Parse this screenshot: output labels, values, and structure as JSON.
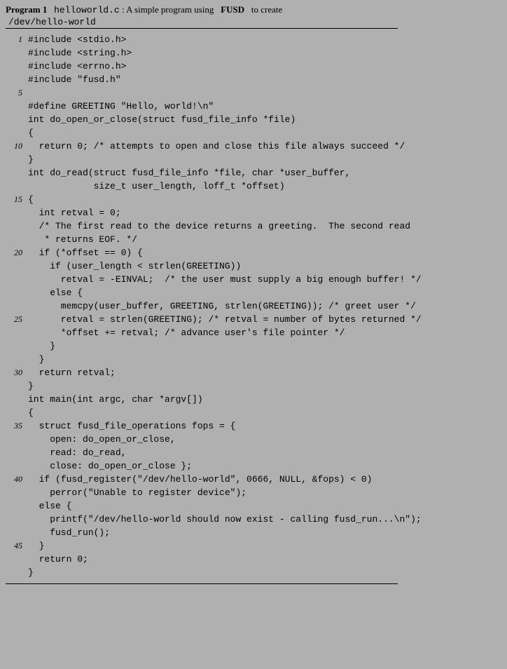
{
  "header": {
    "program_label": "Program  1",
    "filename": "helloworld.c",
    "desc_pre": ":   A  simple  program  using",
    "fusd": "FUSD",
    "desc_post": "to  create",
    "devpath": "/dev/hello-world"
  },
  "code": [
    {
      "n": "1",
      "t": "#include <stdio.h>"
    },
    {
      "n": "",
      "t": "#include <string.h>"
    },
    {
      "n": "",
      "t": "#include <errno.h>"
    },
    {
      "n": "",
      "t": "#include \"fusd.h\""
    },
    {
      "n": "5",
      "t": ""
    },
    {
      "n": "",
      "t": "#define GREETING \"Hello, world!\\n\""
    },
    {
      "n": "",
      "t": ""
    },
    {
      "n": "",
      "t": "int do_open_or_close(struct fusd_file_info *file)"
    },
    {
      "n": "",
      "t": "{"
    },
    {
      "n": "10",
      "t": "  return 0; /* attempts to open and close this file always succeed */"
    },
    {
      "n": "",
      "t": "}"
    },
    {
      "n": "",
      "t": ""
    },
    {
      "n": "",
      "t": "int do_read(struct fusd_file_info *file, char *user_buffer,"
    },
    {
      "n": "",
      "t": "            size_t user_length, loff_t *offset)"
    },
    {
      "n": "15",
      "t": "{"
    },
    {
      "n": "",
      "t": "  int retval = 0;"
    },
    {
      "n": "",
      "t": ""
    },
    {
      "n": "",
      "t": "  /* The first read to the device returns a greeting.  The second read"
    },
    {
      "n": "",
      "t": "   * returns EOF. */"
    },
    {
      "n": "20",
      "t": "  if (*offset == 0) {"
    },
    {
      "n": "",
      "t": "    if (user_length < strlen(GREETING))"
    },
    {
      "n": "",
      "t": "      retval = -EINVAL;  /* the user must supply a big enough buffer! */"
    },
    {
      "n": "",
      "t": "    else {"
    },
    {
      "n": "",
      "t": "      memcpy(user_buffer, GREETING, strlen(GREETING)); /* greet user */"
    },
    {
      "n": "25",
      "t": "      retval = strlen(GREETING); /* retval = number of bytes returned */"
    },
    {
      "n": "",
      "t": "      *offset += retval; /* advance user's file pointer */"
    },
    {
      "n": "",
      "t": "    }"
    },
    {
      "n": "",
      "t": "  }"
    },
    {
      "n": "",
      "t": ""
    },
    {
      "n": "30",
      "t": "  return retval;"
    },
    {
      "n": "",
      "t": "}"
    },
    {
      "n": "",
      "t": ""
    },
    {
      "n": "",
      "t": "int main(int argc, char *argv[])"
    },
    {
      "n": "",
      "t": "{"
    },
    {
      "n": "35",
      "t": "  struct fusd_file_operations fops = {"
    },
    {
      "n": "",
      "t": "    open: do_open_or_close,"
    },
    {
      "n": "",
      "t": "    read: do_read,"
    },
    {
      "n": "",
      "t": "    close: do_open_or_close };"
    },
    {
      "n": "",
      "t": ""
    },
    {
      "n": "40",
      "t": "  if (fusd_register(\"/dev/hello-world\", 0666, NULL, &fops) < 0)"
    },
    {
      "n": "",
      "t": "    perror(\"Unable to register device\");"
    },
    {
      "n": "",
      "t": "  else {"
    },
    {
      "n": "",
      "t": "    printf(\"/dev/hello-world should now exist - calling fusd_run...\\n\");"
    },
    {
      "n": "",
      "t": "    fusd_run();"
    },
    {
      "n": "45",
      "t": "  }"
    },
    {
      "n": "",
      "t": "  return 0;"
    },
    {
      "n": "",
      "t": "}"
    }
  ]
}
